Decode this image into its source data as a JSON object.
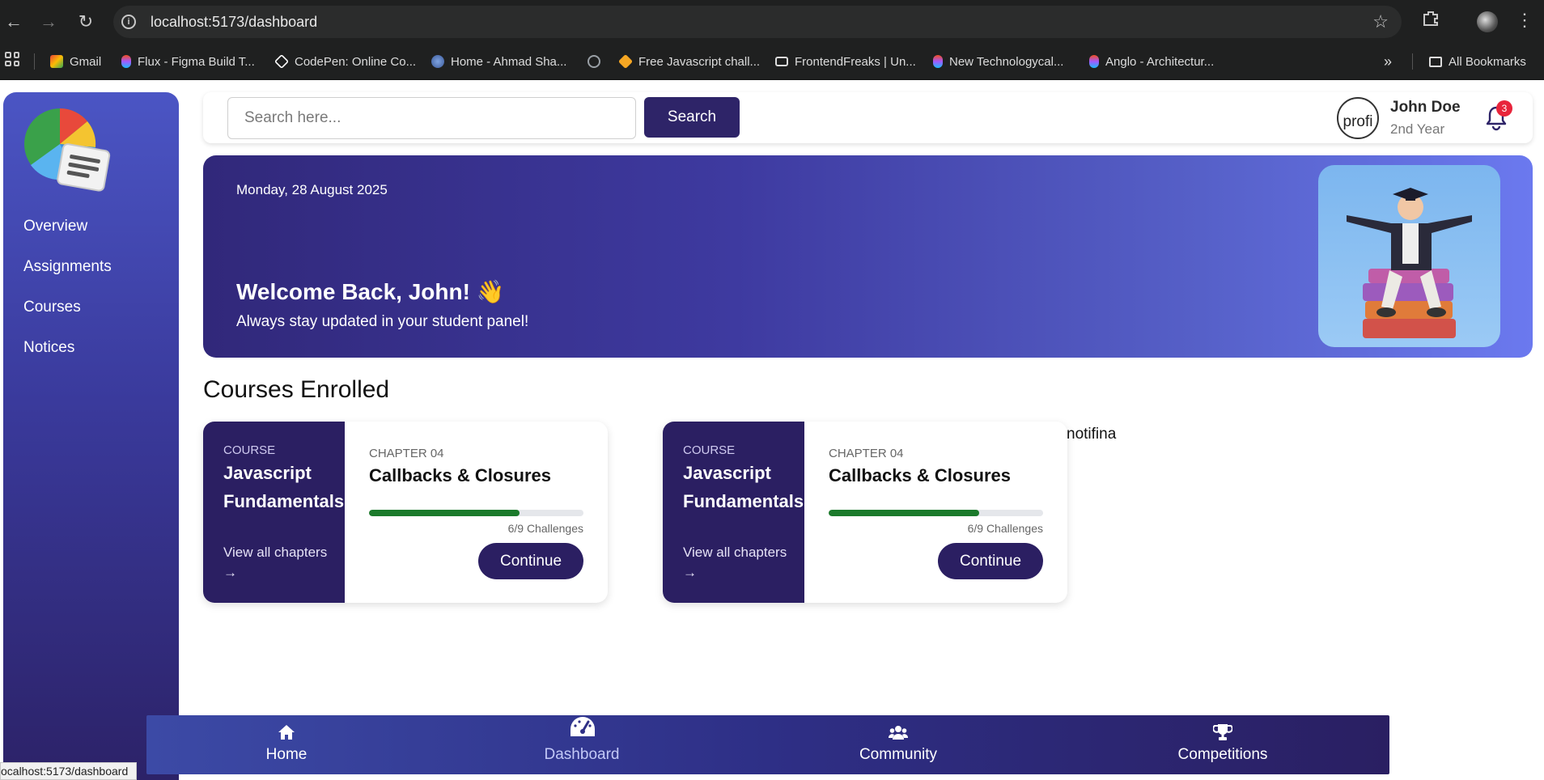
{
  "browser": {
    "url": "localhost:5173/dashboard",
    "bookmarks": [
      {
        "label": "Gmail",
        "color": "#ea4335"
      },
      {
        "label": "Flux - Figma Build T...",
        "color": "#f24e1e"
      },
      {
        "label": "CodePen: Online Co...",
        "color": "#ffffff"
      },
      {
        "label": "Home - Ahmad Sha...",
        "color": "#6a8fd8"
      },
      {
        "label": "",
        "color": "#9aa0a6"
      },
      {
        "label": "Free Javascript chall...",
        "color": "#f5a623"
      },
      {
        "label": "FrontendFreaks | Un...",
        "color": "#dcdcdc"
      },
      {
        "label": "New Technologycal...",
        "color": "#f24e1e"
      },
      {
        "label": "Anglo - Architectur...",
        "color": "#f24e1e"
      }
    ],
    "all_bookmarks": "All Bookmarks",
    "overflow": "»",
    "status_url": "ocalhost:5173/dashboard"
  },
  "sidebar": {
    "items": [
      {
        "label": "Overview"
      },
      {
        "label": "Assignments"
      },
      {
        "label": "Courses"
      },
      {
        "label": "Notices"
      }
    ]
  },
  "topbar": {
    "search_placeholder": "Search here...",
    "search_label": "Search",
    "profile_alt": "profi",
    "user_name": "John Doe",
    "user_year": "2nd Year",
    "notification_count": "3"
  },
  "hero": {
    "date": "Monday, 28 August 2025",
    "title": "Welcome Back, John! 👋",
    "subtitle": "Always stay updated in your student panel!"
  },
  "courses": {
    "section_title": "Courses Enrolled",
    "items": [
      {
        "kicker": "COURSE",
        "name": "Javascript Fundamentals",
        "view_all": "View all chapters →",
        "chapter": "CHAPTER 04",
        "chapter_title": "Callbacks & Closures",
        "progress": 0.7,
        "challenges": "6/9 Challenges",
        "continue_label": "Continue"
      },
      {
        "kicker": "COURSE",
        "name": "Javascript Fundamentals",
        "view_all": "View all chapters →",
        "chapter": "CHAPTER 04",
        "chapter_title": "Callbacks & Closures",
        "progress": 0.7,
        "challenges": "6/9 Challenges",
        "continue_label": "Continue"
      }
    ]
  },
  "stray_text": "notifina",
  "bottom_nav": {
    "items": [
      {
        "label": "Home",
        "icon": "home-icon"
      },
      {
        "label": "Dashboard",
        "icon": "dashboard-gauge-icon",
        "active": true
      },
      {
        "label": "Community",
        "icon": "users-icon"
      },
      {
        "label": "Competitions",
        "icon": "trophy-icon"
      }
    ]
  }
}
